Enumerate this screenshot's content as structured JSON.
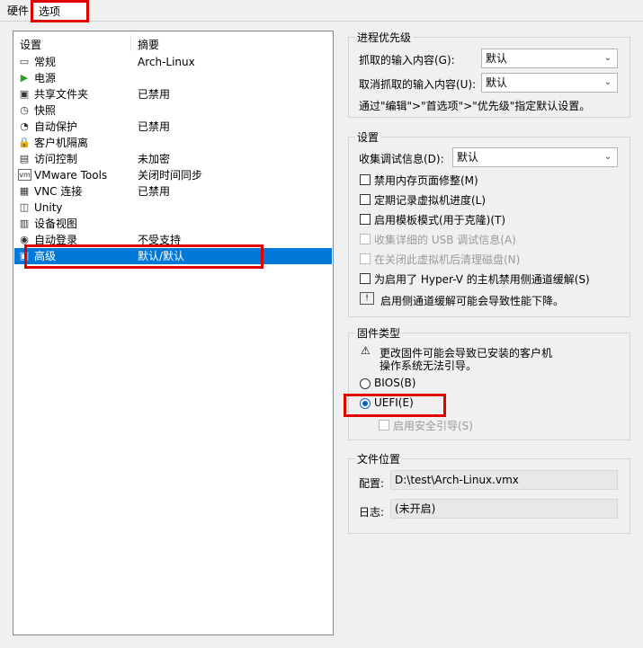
{
  "tabs": {
    "hardware": "硬件",
    "options": "选项"
  },
  "list": {
    "col_settings": "设置",
    "col_summary": "摘要",
    "items": [
      {
        "icon": "display-icon",
        "glyph": "▭",
        "name": "常规",
        "summary": "Arch-Linux"
      },
      {
        "icon": "power-icon",
        "glyph": "▶",
        "name": "电源",
        "summary": ""
      },
      {
        "icon": "shared-folder-icon",
        "glyph": "▣",
        "name": "共享文件夹",
        "summary": "已禁用"
      },
      {
        "icon": "snapshot-icon",
        "glyph": "◷",
        "name": "快照",
        "summary": ""
      },
      {
        "icon": "autoprotect-icon",
        "glyph": "◔",
        "name": "自动保护",
        "summary": "已禁用"
      },
      {
        "icon": "lock-icon",
        "glyph": "🔒",
        "name": "客户机隔离",
        "summary": ""
      },
      {
        "icon": "access-control-icon",
        "glyph": "▤",
        "name": "访问控制",
        "summary": "未加密"
      },
      {
        "icon": "vmware-tools-icon",
        "glyph": "vm",
        "name": "VMware Tools",
        "summary": "关闭时间同步"
      },
      {
        "icon": "vnc-icon",
        "glyph": "▦",
        "name": "VNC 连接",
        "summary": "已禁用"
      },
      {
        "icon": "unity-icon",
        "glyph": "◫",
        "name": "Unity",
        "summary": ""
      },
      {
        "icon": "device-view-icon",
        "glyph": "▥",
        "name": "设备视图",
        "summary": ""
      },
      {
        "icon": "autologin-icon",
        "glyph": "◉",
        "name": "自动登录",
        "summary": "不受支持"
      },
      {
        "icon": "advanced-icon",
        "glyph": "▣",
        "name": "高级",
        "summary": "默认/默认"
      }
    ]
  },
  "priority": {
    "title": "进程优先级",
    "grabbed_label": "抓取的输入内容(G):",
    "grabbed_value": "默认",
    "ungrabbed_label": "取消抓取的输入内容(U):",
    "ungrabbed_value": "默认",
    "note": "通过\"编辑\">\"首选项\">\"优先级\"指定默认设置。"
  },
  "settings": {
    "title": "设置",
    "debug_label": "收集调试信息(D):",
    "debug_value": "默认",
    "opt1": "禁用内存页面修整(M)",
    "opt2": "定期记录虚拟机进度(L)",
    "opt3": "启用模板模式(用于克隆)(T)",
    "opt4": "收集详细的 USB 调试信息(A)",
    "opt5": "在关闭此虚拟机后清理磁盘(N)",
    "opt6": "为启用了 Hyper-V 的主机禁用侧通道缓解(S)",
    "info": "启用侧通道缓解可能会导致性能下降。"
  },
  "firmware": {
    "title": "固件类型",
    "warning_line1": "更改固件可能会导致已安装的客户机",
    "warning_line2": "操作系统无法引导。",
    "bios": "BIOS(B)",
    "uefi": "UEFI(E)",
    "secure_boot": "启用安全引导(S)"
  },
  "file": {
    "title": "文件位置",
    "config_label": "配置:",
    "config_value": "D:\\test\\Arch-Linux.vmx",
    "log_label": "日志:",
    "log_value": "(未开启)"
  },
  "colors": {
    "selection": "#0078d7",
    "highlight_box": "#e00000"
  }
}
